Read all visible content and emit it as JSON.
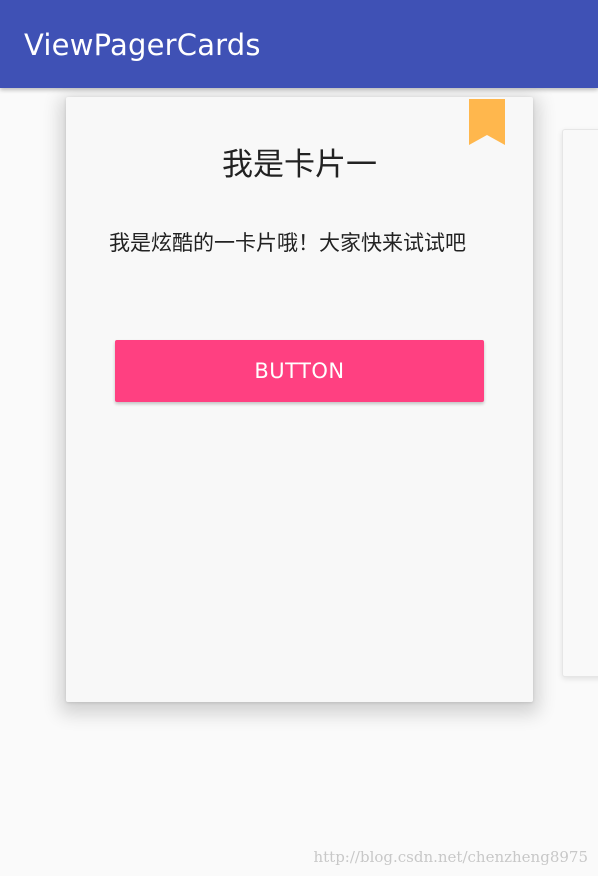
{
  "appbar": {
    "title": "ViewPagerCards",
    "color": "#3f51b5"
  },
  "card": {
    "bookmark_icon": "bookmark-icon",
    "bookmark_color": "#ffb74d",
    "title": "我是卡片一",
    "body": "我是炫酷的一卡片哦！大家快来试试吧",
    "button_label": "BUTTON",
    "button_color": "#ff4081"
  },
  "watermark": "http://blog.csdn.net/chenzheng8975"
}
